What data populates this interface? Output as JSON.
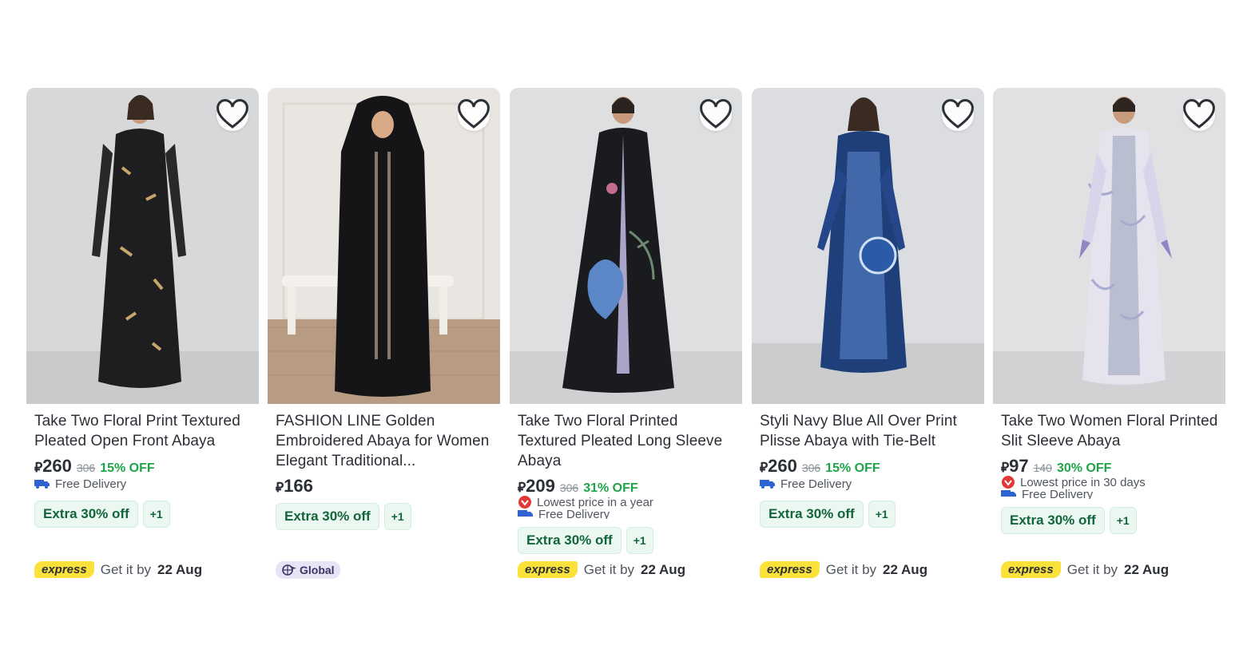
{
  "currency_symbol": "⃁",
  "products": [
    {
      "title": "Take Two Floral Print Textured Pleated Open Front Abaya",
      "price": "260",
      "old_price": "306",
      "discount": "15% OFF",
      "badges": [
        "Free Delivery"
      ],
      "promo": "Extra 30% off",
      "promo_more": "+1",
      "delivery_tag": "express",
      "delivery_text": "Get it by",
      "delivery_date": "22 Aug"
    },
    {
      "title": "FASHION LINE Golden Embroidered Abaya for Women Elegant Traditional...",
      "price": "166",
      "promo": "Extra 30% off",
      "promo_more": "+1",
      "delivery_tag": "Global"
    },
    {
      "title": "Take Two Floral Printed Textured Pleated Long Sleeve Abaya",
      "price": "209",
      "old_price": "306",
      "discount": "31% OFF",
      "badges": [
        "Lowest price in a year",
        "Free Delivery"
      ],
      "promo": "Extra 30% off",
      "promo_more": "+1",
      "delivery_tag": "express",
      "delivery_text": "Get it by",
      "delivery_date": "22 Aug"
    },
    {
      "title": "Styli Navy Blue All Over Print Plisse Abaya with Tie-Belt",
      "price": "260",
      "old_price": "306",
      "discount": "15% OFF",
      "badges": [
        "Free Delivery"
      ],
      "promo": "Extra 30% off",
      "promo_more": "+1",
      "delivery_tag": "express",
      "delivery_text": "Get it by",
      "delivery_date": "22 Aug"
    },
    {
      "title": "Take Two Women Floral Printed Slit Sleeve Abaya",
      "price": "97",
      "old_price": "140",
      "discount": "30% OFF",
      "badges": [
        "Lowest price in 30 days",
        "Free Delivery"
      ],
      "promo": "Extra 30% off",
      "promo_more": "+1",
      "delivery_tag": "express",
      "delivery_text": "Get it by",
      "delivery_date": "22 Aug"
    }
  ],
  "colors": {
    "discount_green": "#1ea548",
    "promo_bg": "#eaf8f1",
    "express_yellow": "#fbe23a",
    "global_purple": "#e7e4f6"
  },
  "icons": {
    "wishlist": "heart-icon",
    "delivery": "truck-icon",
    "lowest_price": "price-drop-icon",
    "global": "globe-plane-icon"
  }
}
